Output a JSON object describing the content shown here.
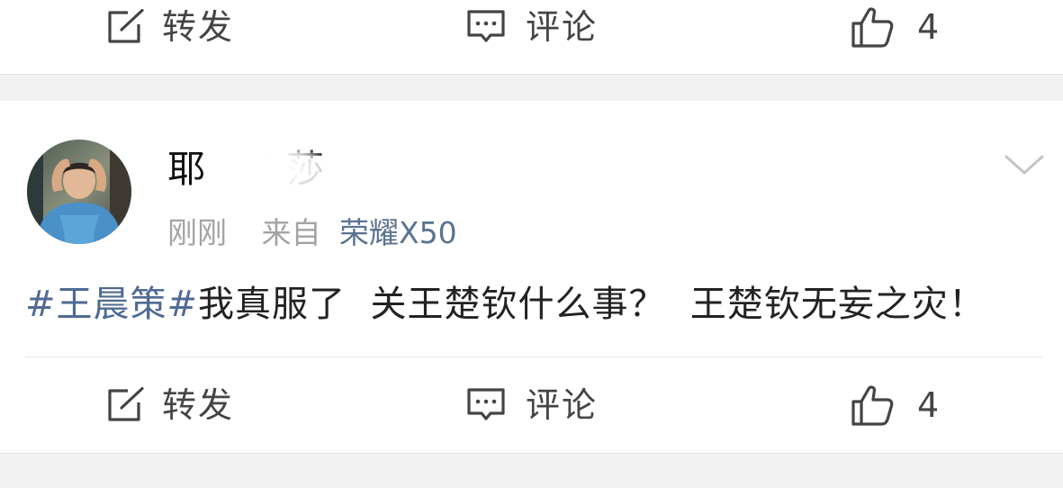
{
  "top_action_bar": {
    "repost_label": "转发",
    "comment_label": "评论",
    "like_count": "4"
  },
  "post": {
    "username_visible_start": "耶",
    "username_visible_end": "莎",
    "time": "刚刚",
    "source_prefix": "来自",
    "device": "荣耀X50",
    "hashtag": "#王晨策#",
    "text": "我真服了  关王楚钦什么事？  王楚钦无妄之灾！",
    "actions": {
      "repost_label": "转发",
      "comment_label": "评论",
      "like_count": "4"
    }
  },
  "icons": {
    "repost": "repost-icon",
    "comment": "comment-icon",
    "like": "like-icon",
    "more": "chevron-down-icon"
  },
  "colors": {
    "background": "#f2f2f2",
    "card": "#ffffff",
    "link": "#4f6a94",
    "device_link": "#5b7290",
    "meta_gray": "#a3a3a3",
    "icon_gray": "#444444"
  }
}
